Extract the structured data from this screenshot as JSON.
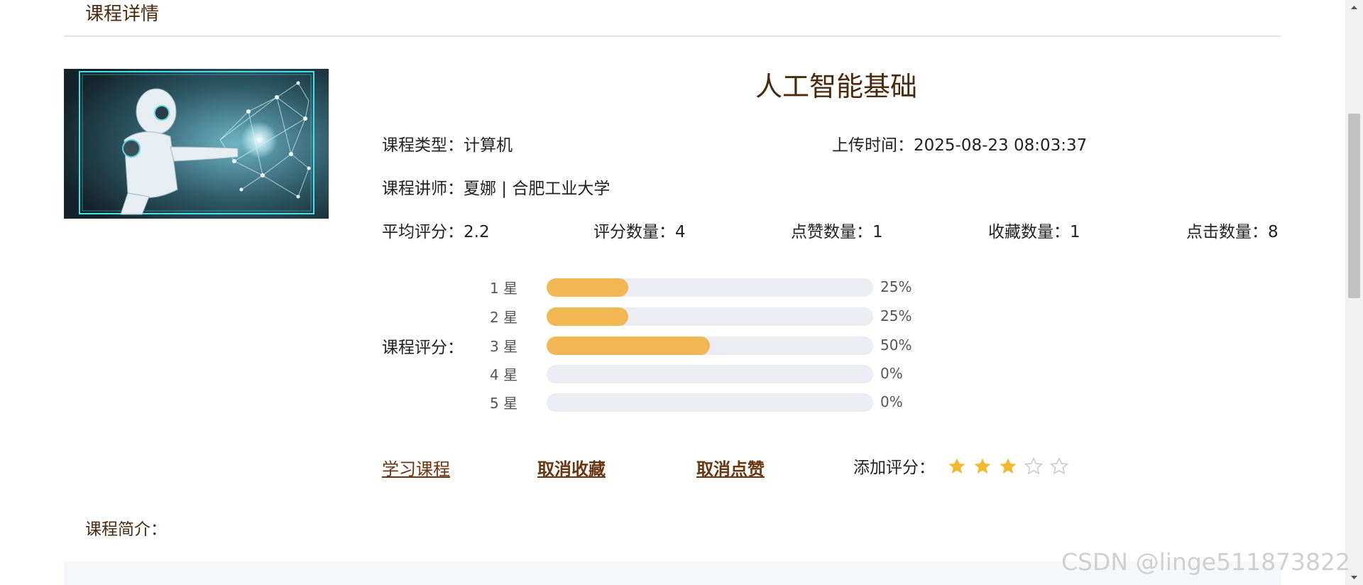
{
  "header": {
    "title": "课程详情"
  },
  "course": {
    "name": "人工智能基础",
    "type_label": "课程类型：",
    "type_value": "计算机",
    "upload_label": "上传时间：",
    "upload_value": "2025-08-23 08:03:37",
    "teacher_label": "课程讲师：",
    "teacher_value": "夏娜 | 合肥工业大学"
  },
  "stats": [
    {
      "label": "平均评分：",
      "value": "2.2"
    },
    {
      "label": "评分数量：",
      "value": "4"
    },
    {
      "label": "点赞数量：",
      "value": "1"
    },
    {
      "label": "收藏数量：",
      "value": "1"
    },
    {
      "label": "点击数量：",
      "value": "8"
    }
  ],
  "rating": {
    "label": "课程评分：",
    "rows": [
      {
        "label": "1 星",
        "percent": 25,
        "text": "25%"
      },
      {
        "label": "2 星",
        "percent": 25,
        "text": "25%"
      },
      {
        "label": "3 星",
        "percent": 50,
        "text": "50%"
      },
      {
        "label": "4 星",
        "percent": 0,
        "text": "0%"
      },
      {
        "label": "5 星",
        "percent": 0,
        "text": "0%"
      }
    ]
  },
  "actions": {
    "study": "学习课程",
    "unfavorite": "取消收藏",
    "unlike": "取消点赞",
    "add_rating_label": "添加评分：",
    "user_stars": 3,
    "max_stars": 5
  },
  "intro": {
    "label": "课程简介："
  },
  "watermark": "CSDN @linge511873822",
  "colors": {
    "accent_brown": "#4a2a0c",
    "link_brown": "#6b3510",
    "bar_fill": "#f1b752",
    "bar_track": "#ecedf4",
    "star_filled": "#f4b82e",
    "star_empty": "#c8c8c8"
  }
}
